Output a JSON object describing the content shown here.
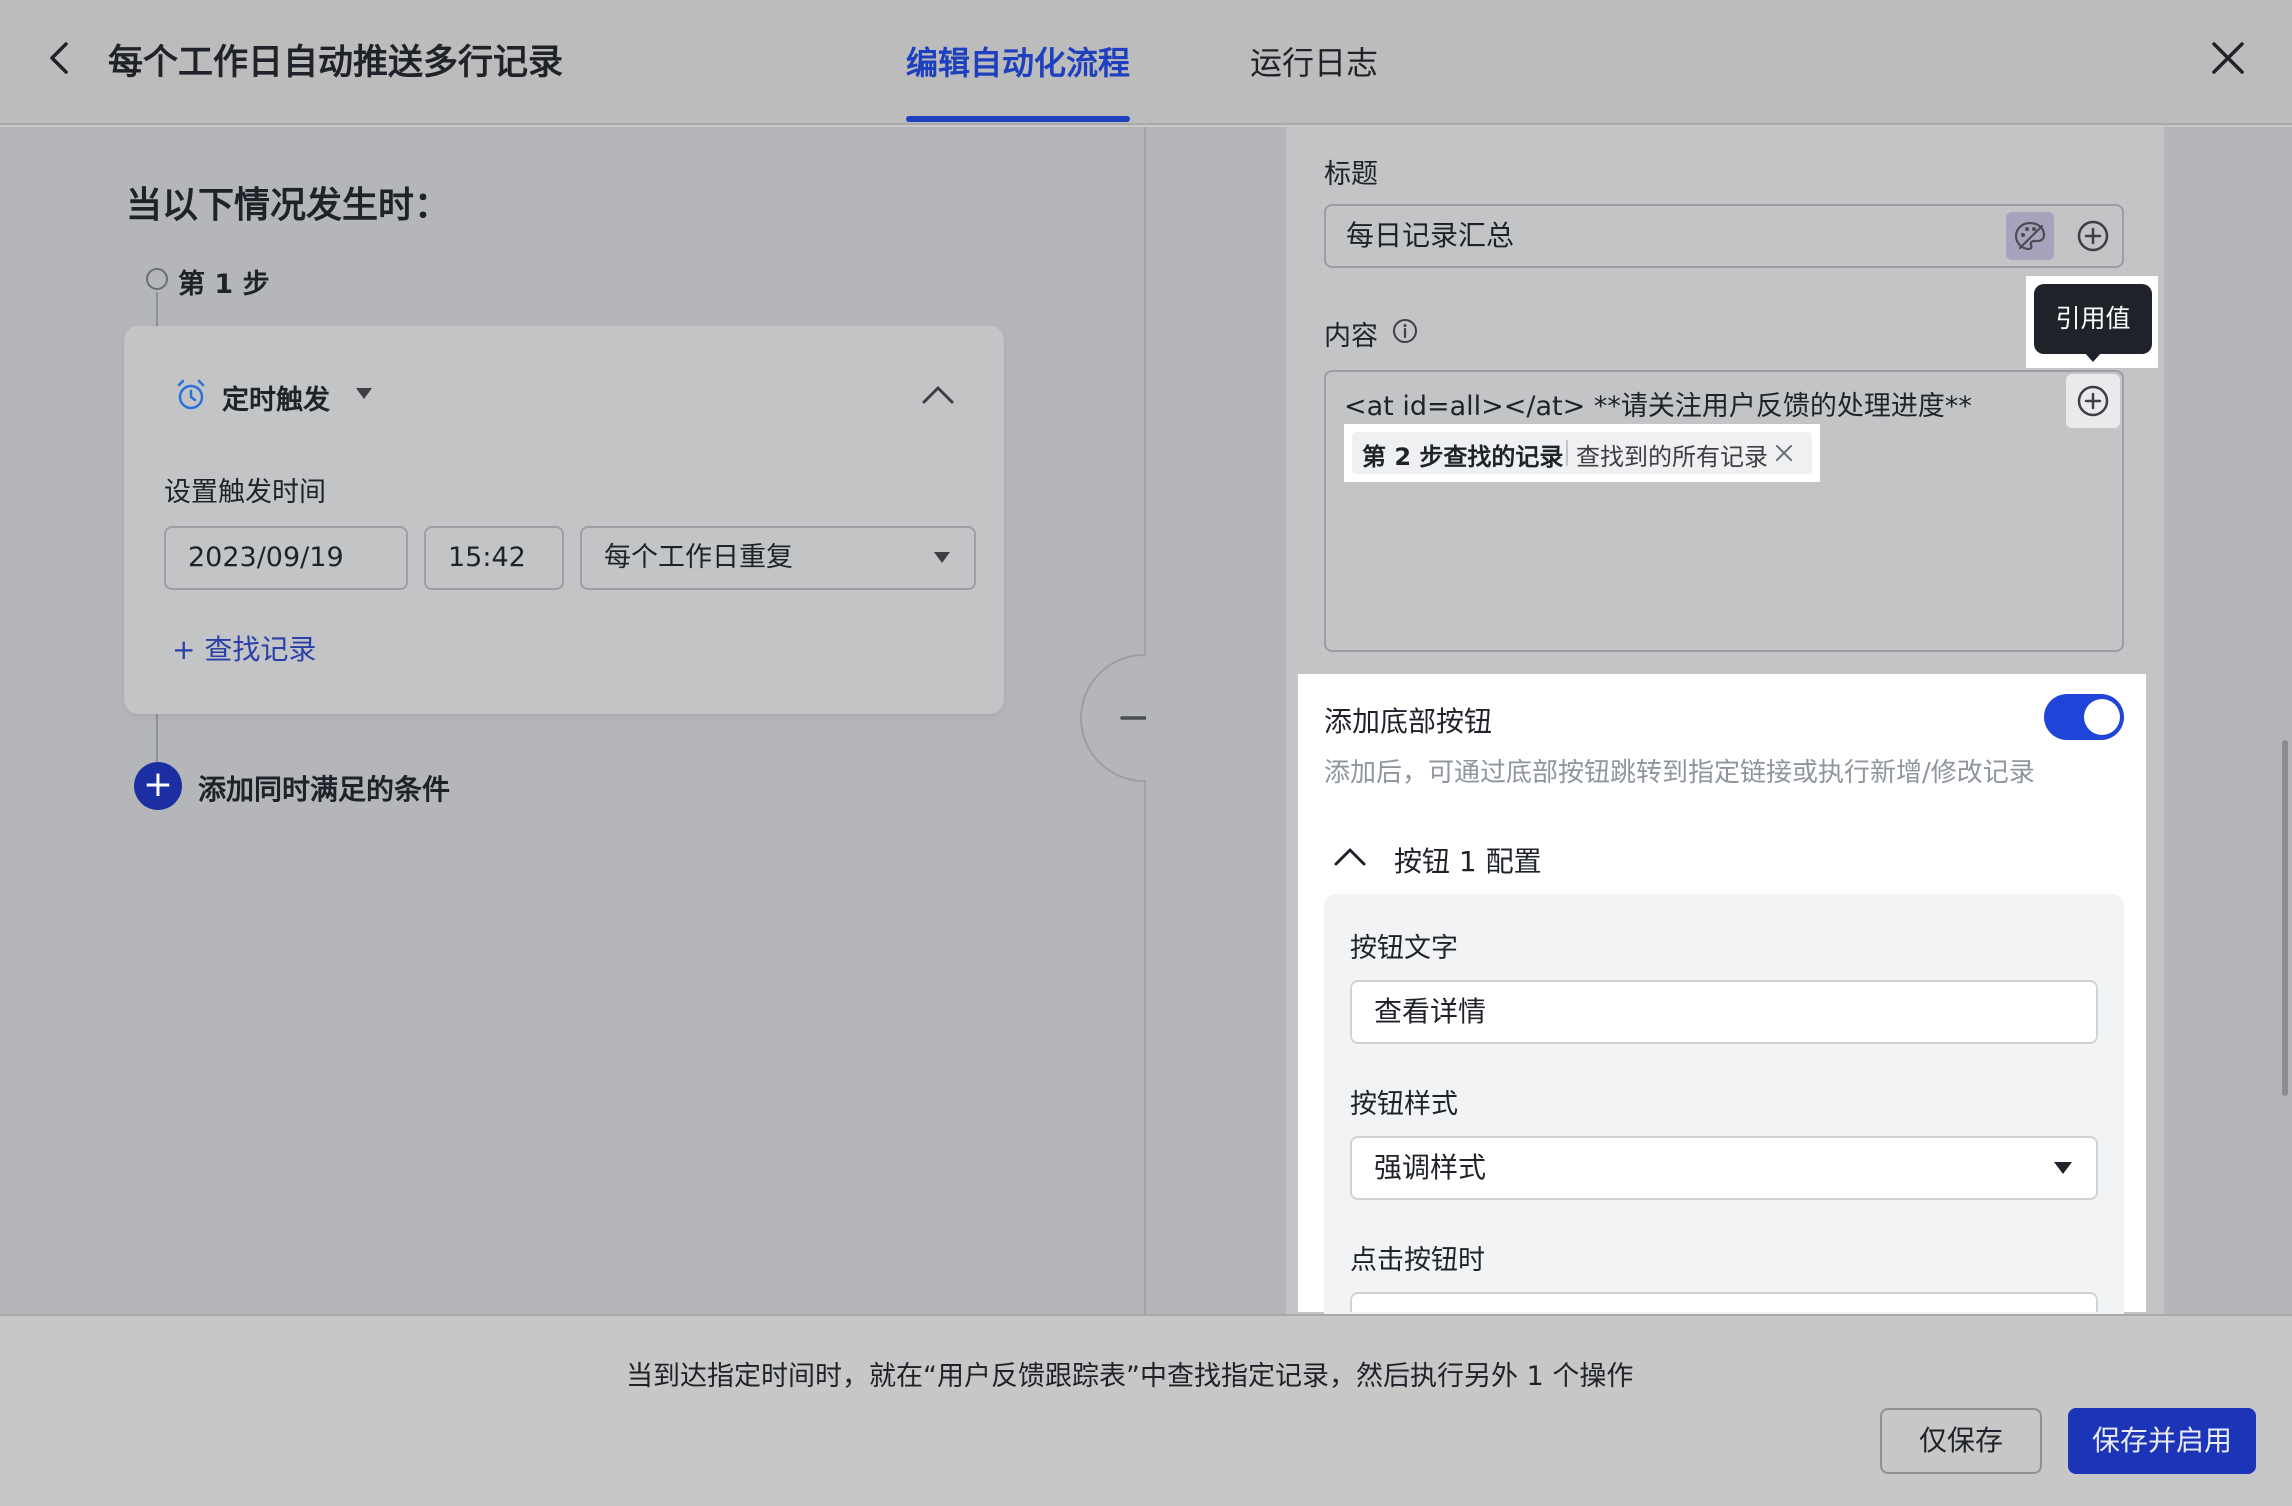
{
  "header": {
    "title": "每个工作日自动推送多行记录",
    "tabs": [
      {
        "label": "编辑自动化流程",
        "active": true
      },
      {
        "label": "运行日志",
        "active": false
      }
    ]
  },
  "left": {
    "when_title": "当以下情况发生时：",
    "step_label": "第 1 步",
    "trigger": {
      "label": "定时触发",
      "set_time_label": "设置触发时间",
      "date": "2023/09/19",
      "time": "15:42",
      "repeat": "每个工作日重复",
      "find_record": "+ 查找记录"
    },
    "add_condition": "添加同时满足的条件"
  },
  "right": {
    "title_label": "标题",
    "title_value": "每日记录汇总",
    "content_label": "内容",
    "content_text": "<at id=all></at> **请关注用户反馈的处理进度**",
    "tooltip": "引用值",
    "chip": {
      "source": "第 2 步查找的记录",
      "field": "查找到的所有记录"
    },
    "add_bottom_button": {
      "label": "添加底部按钮",
      "description": "添加后，可通过底部按钮跳转到指定链接或执行新增/修改记录",
      "enabled": true
    },
    "button_config": {
      "header": "按钮 1 配置",
      "text_label": "按钮文字",
      "text_value": "查看详情",
      "style_label": "按钮样式",
      "style_value": "强调样式",
      "on_click_label": "点击按钮时"
    }
  },
  "footer": {
    "summary": "当到达指定时间时，就在“用户反馈跟踪表”中查找指定记录，然后执行另外 1 个操作",
    "save_only": "仅保存",
    "save_enable": "保存并启用"
  },
  "colors": {
    "accent": "#1e3fbe",
    "toggle_on": "#1f44d8",
    "primary_button": "#1b34b8"
  },
  "icons": [
    "back-icon",
    "close-icon",
    "alarm-clock-icon",
    "chevron-up-icon",
    "caret-down-icon",
    "plus-circle-icon",
    "arrow-right-icon",
    "info-icon",
    "palette-icon",
    "x-icon"
  ]
}
